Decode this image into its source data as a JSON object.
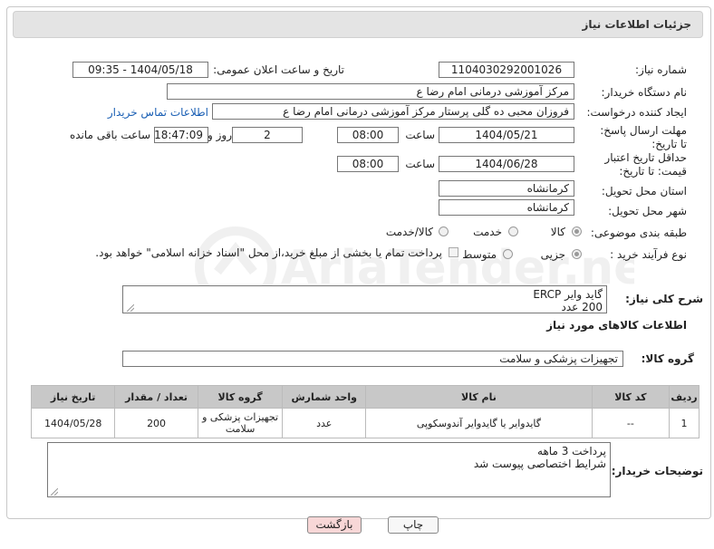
{
  "header": {
    "title": "جزئیات اطلاعات نیاز"
  },
  "form": {
    "need_number_label": "شماره نیاز:",
    "need_number": "1104030292001026",
    "announce_label": "تاریخ و ساعت اعلان عمومی:",
    "announce_value": "1404/05/18 - 09:35",
    "buyer_org_label": "نام دستگاه خریدار:",
    "buyer_org": "مرکز آموزشی  درمانی امام رضا  ع",
    "requester_label": "ایجاد کننده درخواست:",
    "requester": "فروزان محبی ده گلی پرستار مرکز آموزشی  درمانی امام رضا  ع",
    "contact_link": "اطلاعات تماس خریدار",
    "deadline_label": "مهلت ارسال پاسخ: تا تاریخ:",
    "deadline_date": "1404/05/21",
    "time_label": "ساعت",
    "deadline_time": "08:00",
    "days_value": "2",
    "days_label": "روز و",
    "remaining_time": "18:47:09",
    "remaining_label": "ساعت باقی مانده",
    "price_validity_label": "حداقل تاریخ اعتبار قیمت: تا تاریخ:",
    "price_validity_date": "1404/06/28",
    "price_validity_time": "08:00",
    "province_label": "استان محل تحویل:",
    "province": "کرمانشاه",
    "city_label": "شهر محل تحویل:",
    "city": "کرمانشاه",
    "category_label": "طبقه بندی موضوعی:",
    "category_options": [
      "کالا",
      "خدمت",
      "کالا/خدمت"
    ],
    "category_selected": "کالا",
    "process_label": "نوع فرآیند خرید :",
    "process_options": [
      "جزیی",
      "متوسط"
    ],
    "process_selected": "جزیی",
    "payment_note": "پرداخت تمام یا بخشی از مبلغ خرید،از محل \"اسناد خزانه اسلامی\" خواهد بود."
  },
  "description": {
    "label": "شرح کلی نیاز:",
    "text": "گاید وایر ERCP\n200 عدد"
  },
  "items_section": {
    "title": "اطلاعات کالاهای مورد نیاز",
    "group_label": "گروه کالا:",
    "group_value": "تجهیزات پزشکی و سلامت"
  },
  "table": {
    "headers": [
      "ردیف",
      "کد کالا",
      "نام کالا",
      "واحد شمارش",
      "گروه کالا",
      "تعداد / مقدار",
      "تاریخ نیاز"
    ],
    "rows": [
      [
        "1",
        "--",
        "گایدوایر یا گایدوایر آندوسکوپی",
        "عدد",
        "تجهیزات پزشکی و سلامت",
        "200",
        "1404/05/28"
      ]
    ]
  },
  "buyer_notes": {
    "label": "توضیحات خریدار:",
    "text": "پرداخت 3 ماهه\nشرایط اختصاصی پیوست شد"
  },
  "buttons": {
    "print": "چاپ",
    "back": "بازگشت"
  },
  "watermark": {
    "text": "AriaTender.net"
  },
  "colors": {
    "header_bg": "#e4e4e4",
    "table_header_bg": "#c8c8c8",
    "link": "#1a5fb4",
    "back_button_bg": "#f8d7d7"
  }
}
